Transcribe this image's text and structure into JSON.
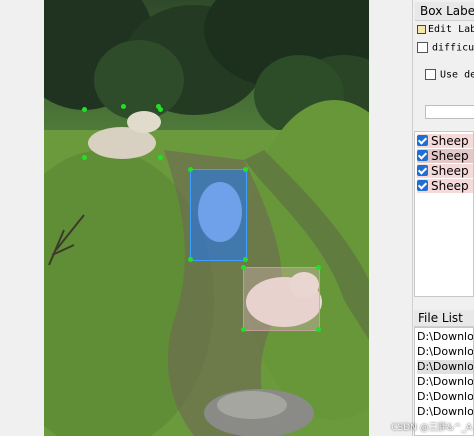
{
  "dock": {
    "box_labels_title": "Box Labels",
    "edit_label_button": "Edit Labe",
    "difficult_label": "difficul",
    "use_default_label": "Use de"
  },
  "label_list": [
    {
      "text": "Sheep",
      "checked": true
    },
    {
      "text": "Sheep",
      "checked": true
    },
    {
      "text": "Sheep",
      "checked": true
    },
    {
      "text": "Sheep",
      "checked": true
    }
  ],
  "file_list": {
    "title": "File List",
    "items": [
      "D:\\Download",
      "D:\\Download",
      "D:\\Download",
      "D:\\Download",
      "D:\\Download",
      "D:\\Download"
    ]
  },
  "watermark": "CSDN @三胖&^_A",
  "colors": {
    "selected_box_fill": "#1e78ff",
    "handle": "#22e02a",
    "checkbox_blue": "#1f6fd2"
  }
}
